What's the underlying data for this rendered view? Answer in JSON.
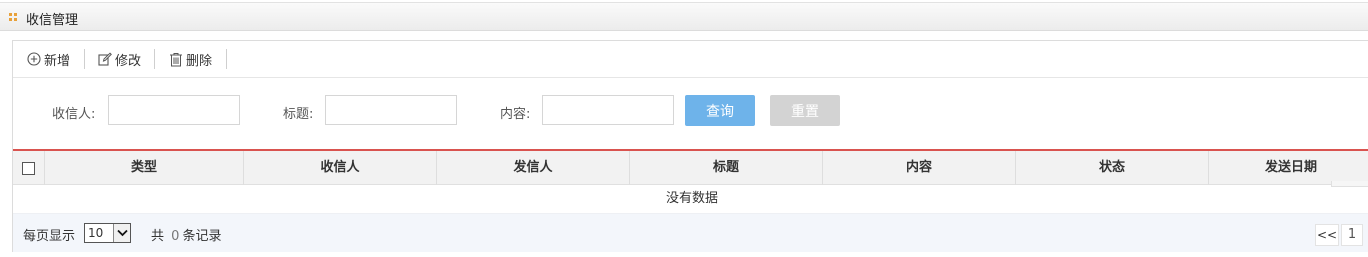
{
  "page": {
    "title": "收信管理",
    "accent_color": "#e8a13a"
  },
  "toolbar": {
    "add_label": "新增",
    "edit_label": "修改",
    "delete_label": "删除"
  },
  "search": {
    "recipient_label": "收信人:",
    "subject_label": "标题:",
    "content_label": "内容:",
    "recipient_value": "",
    "subject_value": "",
    "content_value": "",
    "query_label": "查询",
    "reset_label": "重置",
    "query_color": "#6eb3ea",
    "reset_color": "#d3d3d3"
  },
  "grid": {
    "columns": [
      "类型",
      "收信人",
      "发信人",
      "标题",
      "内容",
      "状态",
      "发送日期"
    ],
    "empty_text": "没有数据",
    "header_line_color": "#d9534f"
  },
  "pager": {
    "per_page_label": "每页显示",
    "per_page_value": "10",
    "total_prefix": "共",
    "total_count": "0",
    "total_suffix": "条记录",
    "prev_label": "<<",
    "current_page": "1"
  }
}
